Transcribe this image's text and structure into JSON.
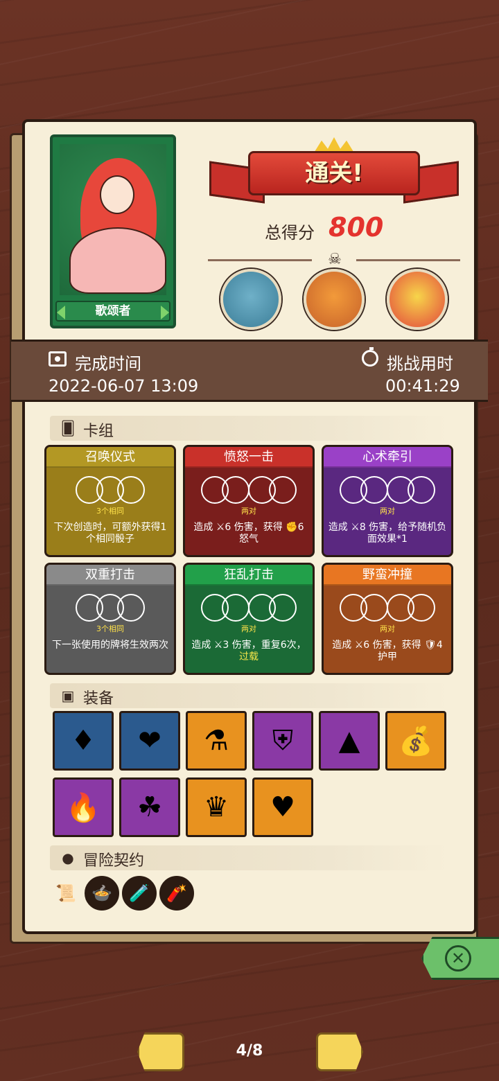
{
  "hero": {
    "name": "歌颂者"
  },
  "result": {
    "banner": "通关!",
    "score_label": "总得分",
    "score_value": "800"
  },
  "info": {
    "finish_label": "完成时间",
    "finish_value": "2022-06-07 13:09",
    "duration_label": "挑战用时",
    "duration_value": "00:41:29"
  },
  "sections": {
    "deck": "卡组",
    "equipment": "装备",
    "contracts": "冒险契约"
  },
  "cards": [
    {
      "title": "召唤仪式",
      "sub": "3个相同",
      "desc": "下次创造时，可额外获得1个相同骰子",
      "color": "#b39824",
      "body": "#9a7e1a",
      "dice": 3
    },
    {
      "title": "愤怒一击",
      "sub": "两对",
      "desc": "造成 ⚔6 伤害，获得 ✊6 怒气",
      "color": "#c9312a",
      "body": "#7a1e1c",
      "dice": 4
    },
    {
      "title": "心术牵引",
      "sub": "两对",
      "desc": "造成 ⚔8 伤害，给予随机负面效果*1",
      "color": "#9a41c7",
      "body": "#5a2880",
      "dice": 4
    },
    {
      "title": "双重打击",
      "sub": "3个相同",
      "desc": "下一张使用的牌将生效两次",
      "color": "#8a8a8a",
      "body": "#5a5a5a",
      "dice": 3
    },
    {
      "title": "狂乱打击",
      "sub": "两对",
      "desc": "造成 ⚔3 伤害，重复6次，",
      "desc_extra": "过载",
      "color": "#22a04a",
      "body": "#1b6a36",
      "dice": 4
    },
    {
      "title": "野蛮冲撞",
      "sub": "两对",
      "desc": "造成 ⚔6 伤害，获得 🛡4 护甲",
      "color": "#e87622",
      "body": "#9a4a1c",
      "dice": 4
    }
  ],
  "pager": {
    "text": "4/8"
  },
  "colors": {
    "accent": "#e4332e",
    "board": "#f7efd9",
    "wood": "#5a2a1c"
  }
}
